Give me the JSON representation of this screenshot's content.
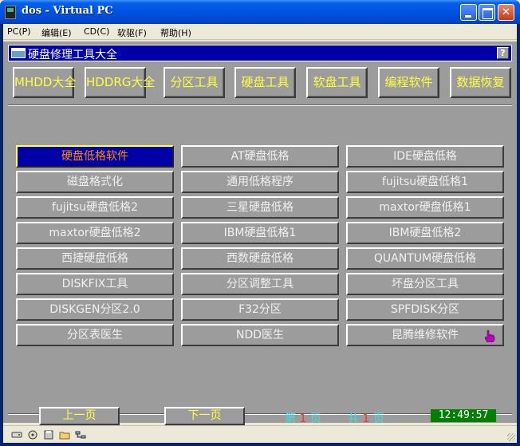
{
  "window": {
    "title": "dos - Virtual PC",
    "minimize_label": "",
    "maximize_label": "",
    "close_label": "✕"
  },
  "menubar": {
    "items": [
      {
        "label": "PC(P)"
      },
      {
        "label": "编辑(E)"
      },
      {
        "label": "CD(C)"
      },
      {
        "label": "软驱(F)"
      },
      {
        "label": "帮助(H)"
      }
    ]
  },
  "dos_app": {
    "title": "硬盘修理工具大全",
    "help_label": "?",
    "top_buttons": [
      {
        "label": "MHDD大全"
      },
      {
        "label": "HDDRG大全"
      },
      {
        "label": "分区工具"
      },
      {
        "label": "硬盘工具"
      },
      {
        "label": "软盘工具"
      },
      {
        "label": "编程软件"
      },
      {
        "label": "数据恢复"
      }
    ],
    "items": [
      {
        "label": "硬盘低格软件",
        "selected": true
      },
      {
        "label": "AT硬盘低格"
      },
      {
        "label": "IDE硬盘低格"
      },
      {
        "label": "磁盘格式化"
      },
      {
        "label": "通用低格程序"
      },
      {
        "label": "fujitsu硬盘低格1"
      },
      {
        "label": "fujitsu硬盘低格2"
      },
      {
        "label": "三星硬盘低格"
      },
      {
        "label": "maxtor硬盘低格1"
      },
      {
        "label": "maxtor硬盘低格2"
      },
      {
        "label": "IBM硬盘低格1"
      },
      {
        "label": "IBM硬盘低格2"
      },
      {
        "label": "西捷硬盘低格"
      },
      {
        "label": "西数硬盘低格"
      },
      {
        "label": "QUANTUM硬盘低格"
      },
      {
        "label": "DISKFIX工具"
      },
      {
        "label": "分区调整工具"
      },
      {
        "label": "坏盘分区工具"
      },
      {
        "label": "DISKGEN分区2.0"
      },
      {
        "label": "F32分区"
      },
      {
        "label": "SPFDISK分区"
      },
      {
        "label": "分区表医生"
      },
      {
        "label": "NDD医生"
      },
      {
        "label": "昆腾维修软件"
      }
    ],
    "prev_page": "上一页",
    "next_page": "下一页",
    "page_prefix": "第",
    "page_current": "1",
    "page_suffix": "页",
    "total_prefix": "共",
    "page_total": "1",
    "total_suffix": "页",
    "clock": "12:49:57",
    "colors": {
      "background": "#9c9c9c",
      "title_bar": "#0000a8",
      "button_text": "#ffff40",
      "selected_text": "#ff8c00",
      "page_info": "#40e0e0",
      "clock_bg": "#008000"
    }
  },
  "statusbar": {
    "icons": [
      "hard-disk-icon",
      "cd-icon",
      "floppy-icon",
      "shared-folder-icon",
      "network-icon"
    ]
  }
}
